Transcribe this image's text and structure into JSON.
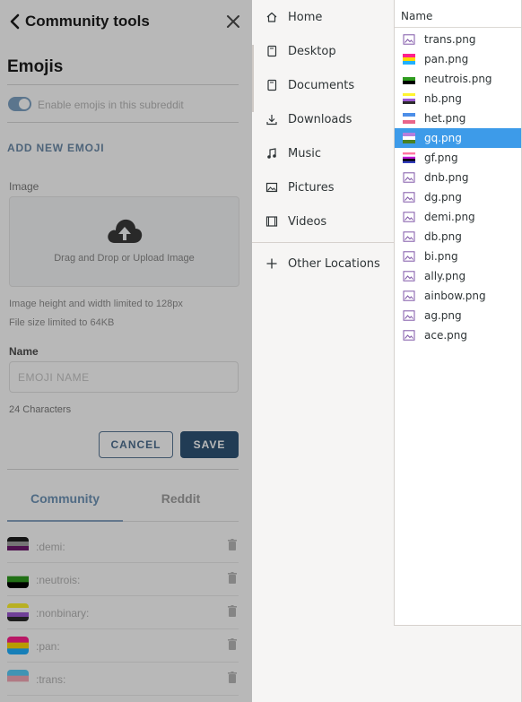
{
  "reddit": {
    "header_title": "Community tools",
    "section_title": "Emojis",
    "toggle_label": "Enable emojis in this subreddit",
    "add_new": "ADD NEW EMOJI",
    "image_label": "Image",
    "dropzone_text": "Drag and Drop or Upload Image",
    "hint_size": "Image height and width limited to 128px",
    "hint_file": "File size limited to 64KB",
    "name_label": "Name",
    "name_placeholder": "EMOJI NAME",
    "chars": "24 Characters",
    "cancel": "CANCEL",
    "save": "SAVE",
    "tab_community": "Community",
    "tab_reddit": "Reddit",
    "emojis": [
      {
        "name": ":demi:",
        "colors": [
          "#1c1c1c",
          "#a3a3a3",
          "#6e1a6e",
          "#ffffff"
        ]
      },
      {
        "name": ":neutrois:",
        "colors": [
          "#ffffff",
          "#2f9c1f",
          "#000000"
        ]
      },
      {
        "name": ":nonbinary:",
        "colors": [
          "#fff430",
          "#ffffff",
          "#9c59d1",
          "#2c2c2c"
        ]
      },
      {
        "name": ":pan:",
        "colors": [
          "#ff218c",
          "#ffd800",
          "#21b1ff"
        ]
      },
      {
        "name": ":trans:",
        "colors": [
          "#5bcefa",
          "#f5a9b8",
          "#ffffff"
        ]
      }
    ]
  },
  "places": [
    {
      "label": "Home",
      "icon": "home-icon"
    },
    {
      "label": "Desktop",
      "icon": "desktop-icon"
    },
    {
      "label": "Documents",
      "icon": "documents-icon"
    },
    {
      "label": "Downloads",
      "icon": "downloads-icon"
    },
    {
      "label": "Music",
      "icon": "music-icon"
    },
    {
      "label": "Pictures",
      "icon": "pictures-icon"
    },
    {
      "label": "Videos",
      "icon": "videos-icon"
    },
    {
      "label": "Other Locations",
      "icon": "plus-icon"
    }
  ],
  "file_list": {
    "column_header": "Name",
    "selected": "gq.png",
    "files": [
      {
        "name": "trans.png",
        "icon": "image-file-icon"
      },
      {
        "name": "pan.png",
        "icon": "pan-flag-thumb",
        "colors": [
          "#ff218c",
          "#ffd800",
          "#21b1ff"
        ]
      },
      {
        "name": "neutrois.png",
        "icon": "neutrois-flag-thumb",
        "colors": [
          "#ffffff",
          "#2f9c1f",
          "#000000"
        ]
      },
      {
        "name": "nb.png",
        "icon": "nb-flag-thumb",
        "colors": [
          "#fff430",
          "#ffffff",
          "#9c59d1",
          "#2c2c2c"
        ]
      },
      {
        "name": "het.png",
        "icon": "het-flag-thumb",
        "colors": [
          "#4c8ee8",
          "#ffffff",
          "#e9658a"
        ]
      },
      {
        "name": "gq.png",
        "icon": "gq-flag-thumb",
        "colors": [
          "#b57edc",
          "#ffffff",
          "#4a8123"
        ]
      },
      {
        "name": "gf.png",
        "icon": "gf-flag-thumb",
        "colors": [
          "#ff75a2",
          "#ffffff",
          "#be18d6",
          "#000000",
          "#333ebd"
        ]
      },
      {
        "name": "dnb.png",
        "icon": "image-file-icon"
      },
      {
        "name": "dg.png",
        "icon": "image-file-icon"
      },
      {
        "name": "demi.png",
        "icon": "image-file-icon"
      },
      {
        "name": "db.png",
        "icon": "image-file-icon"
      },
      {
        "name": "bi.png",
        "icon": "image-file-icon"
      },
      {
        "name": "ally.png",
        "icon": "image-file-icon"
      },
      {
        "name": "ainbow.png",
        "icon": "image-file-icon"
      },
      {
        "name": "ag.png",
        "icon": "image-file-icon"
      },
      {
        "name": "ace.png",
        "icon": "image-file-icon"
      }
    ]
  }
}
